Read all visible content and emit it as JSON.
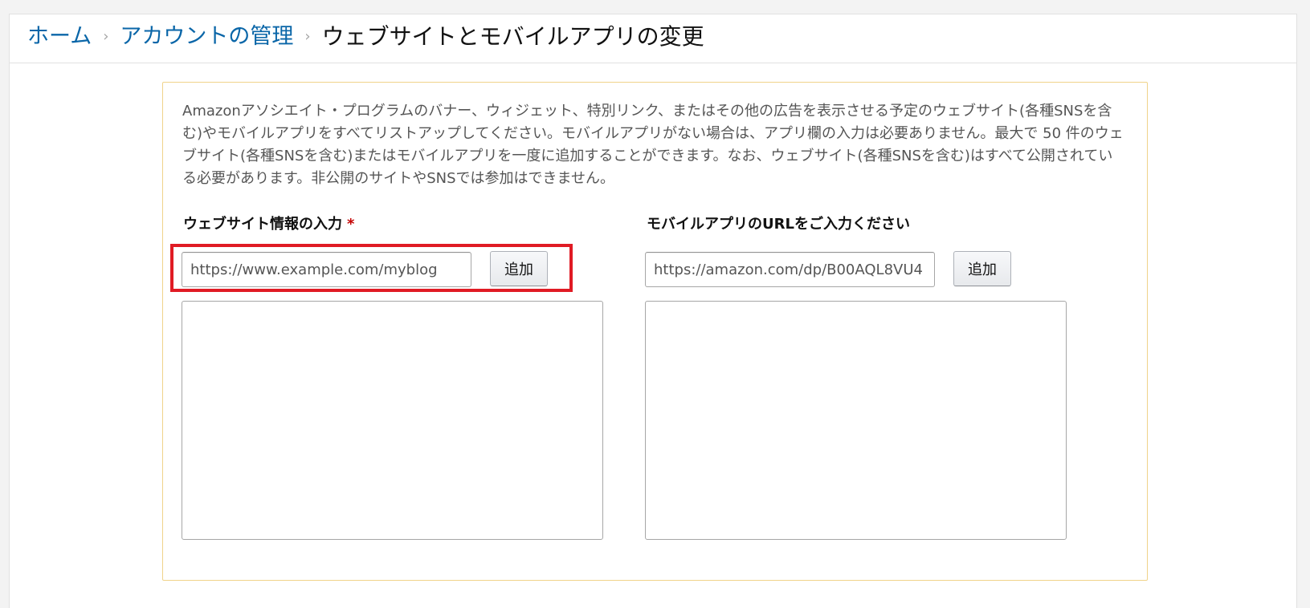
{
  "breadcrumb": {
    "home": "ホーム",
    "account_management": "アカウントの管理",
    "current": "ウェブサイトとモバイルアプリの変更",
    "separator": "›"
  },
  "form": {
    "description": "Amazonアソシエイト・プログラムのバナー、ウィジェット、特別リンク、またはその他の広告を表示させる予定のウェブサイト(各種SNSを含む)やモバイルアプリをすべてリストアップしてください。モバイルアプリがない場合は、アプリ欄の入力は必要ありません。最大で 50 件のウェブサイト(各種SNSを含む)またはモバイルアプリを一度に追加することができます。なお、ウェブサイト(各種SNSを含む)はすべて公開されている必要があります。非公開のサイトやSNSでは参加はできません。",
    "website": {
      "label": "ウェブサイト情報の入力",
      "required_mark": "*",
      "placeholder": "https://www.example.com/myblog",
      "add_label": "追加"
    },
    "mobile_app": {
      "label": "モバイルアプリのURLをご入力ください",
      "placeholder": "https://amazon.com/dp/B00AQL8VU4",
      "add_label": "追加"
    }
  },
  "colors": {
    "link": "#0a66a8",
    "form_border": "#f0d38a",
    "highlight": "#e01b24",
    "required": "#c40000"
  }
}
